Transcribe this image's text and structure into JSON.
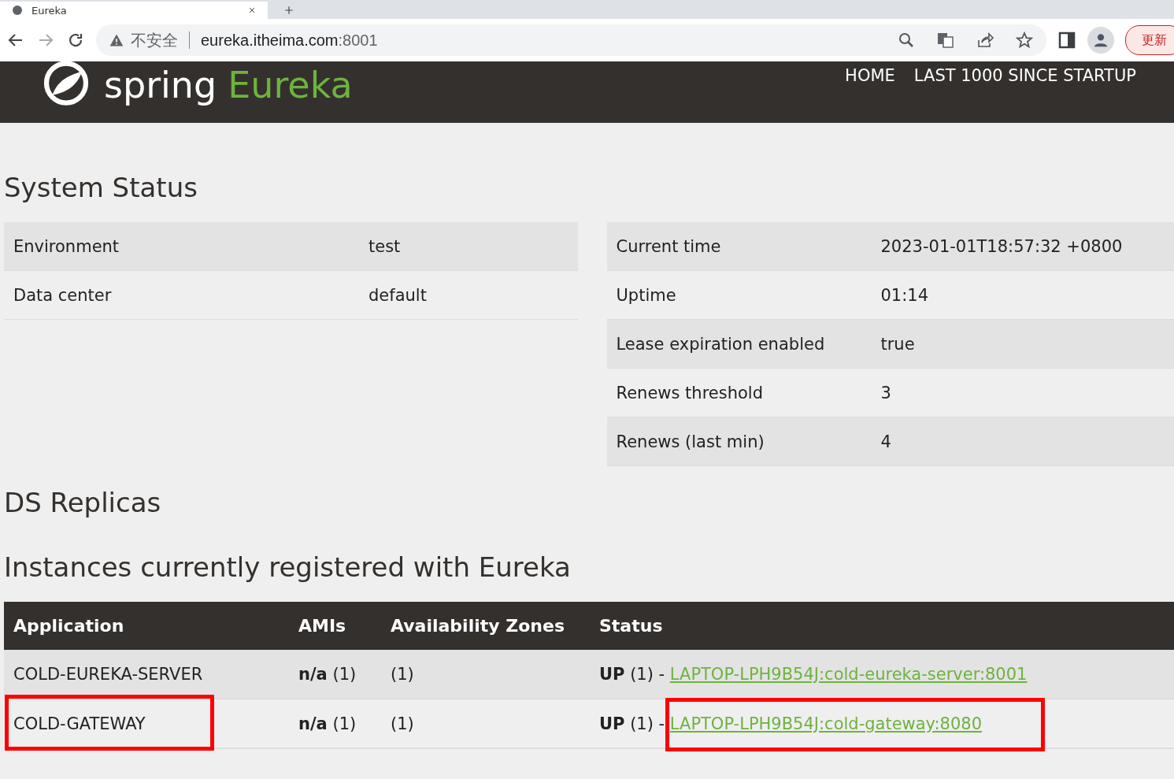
{
  "browser": {
    "tab": {
      "title": "Eureka"
    },
    "address": {
      "warning": "不安全",
      "url": "eureka.itheima.com",
      "port": ":8001"
    },
    "update_button": "更新"
  },
  "header": {
    "logo": {
      "word1": "spring",
      "word2": "Eureka"
    },
    "nav": [
      "HOME",
      "LAST 1000 SINCE STARTUP"
    ]
  },
  "system_status": {
    "title": "System Status",
    "left_table": [
      {
        "label": "Environment",
        "value": "test"
      },
      {
        "label": "Data center",
        "value": "default"
      }
    ],
    "right_table": [
      {
        "label": "Current time",
        "value": "2023-01-01T18:57:32 +0800"
      },
      {
        "label": "Uptime",
        "value": "01:14"
      },
      {
        "label": "Lease expiration enabled",
        "value": "true"
      },
      {
        "label": "Renews threshold",
        "value": "3"
      },
      {
        "label": "Renews (last min)",
        "value": "4"
      }
    ]
  },
  "ds_replicas": {
    "title": "DS Replicas"
  },
  "instances": {
    "title": "Instances currently registered with Eureka",
    "columns": [
      "Application",
      "AMIs",
      "Availability Zones",
      "Status"
    ],
    "rows": [
      {
        "application": "COLD-EUREKA-SERVER",
        "amis": "**n/a** (1)",
        "zones": "(1)",
        "status": "**UP** (1) -",
        "link": "LAPTOP-LPH9B54J:cold-eureka-server:8001",
        "annotated": false
      },
      {
        "application": "COLD-GATEWAY",
        "amis": "**n/a** (1)",
        "zones": "(1)",
        "status": "**UP** (1) -",
        "link": "LAPTOP-LPH9B54J:cold-gateway:8080",
        "annotated": true
      }
    ]
  }
}
